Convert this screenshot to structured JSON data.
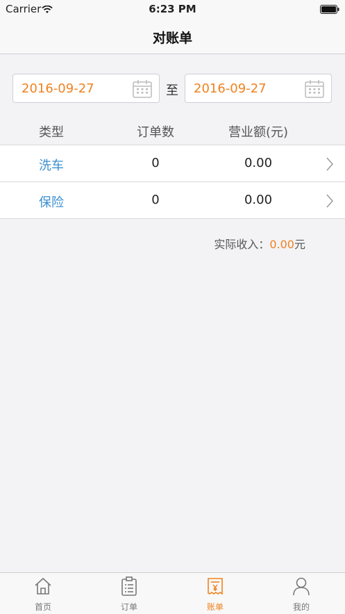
{
  "status_bar": {
    "carrier": "Carrier",
    "time": "6:23 PM"
  },
  "nav": {
    "title": "对账单"
  },
  "date_range": {
    "start": "2016-09-27",
    "separator": "至",
    "end": "2016-09-27"
  },
  "table": {
    "headers": {
      "type": "类型",
      "orders": "订单数",
      "revenue": "营业额(元)"
    },
    "rows": [
      {
        "type": "洗车",
        "orders": "0",
        "revenue": "0.00"
      },
      {
        "type": "保险",
        "orders": "0",
        "revenue": "0.00"
      }
    ]
  },
  "income": {
    "label": "实际收入：",
    "value": "0.00",
    "unit": "元"
  },
  "tabs": [
    {
      "label": "首页",
      "icon": "home-icon"
    },
    {
      "label": "订单",
      "icon": "order-list-icon"
    },
    {
      "label": "账单",
      "icon": "bill-icon",
      "active": true
    },
    {
      "label": "我的",
      "icon": "user-icon"
    }
  ],
  "colors": {
    "accent": "#f0821e",
    "link": "#3a8fd0"
  }
}
